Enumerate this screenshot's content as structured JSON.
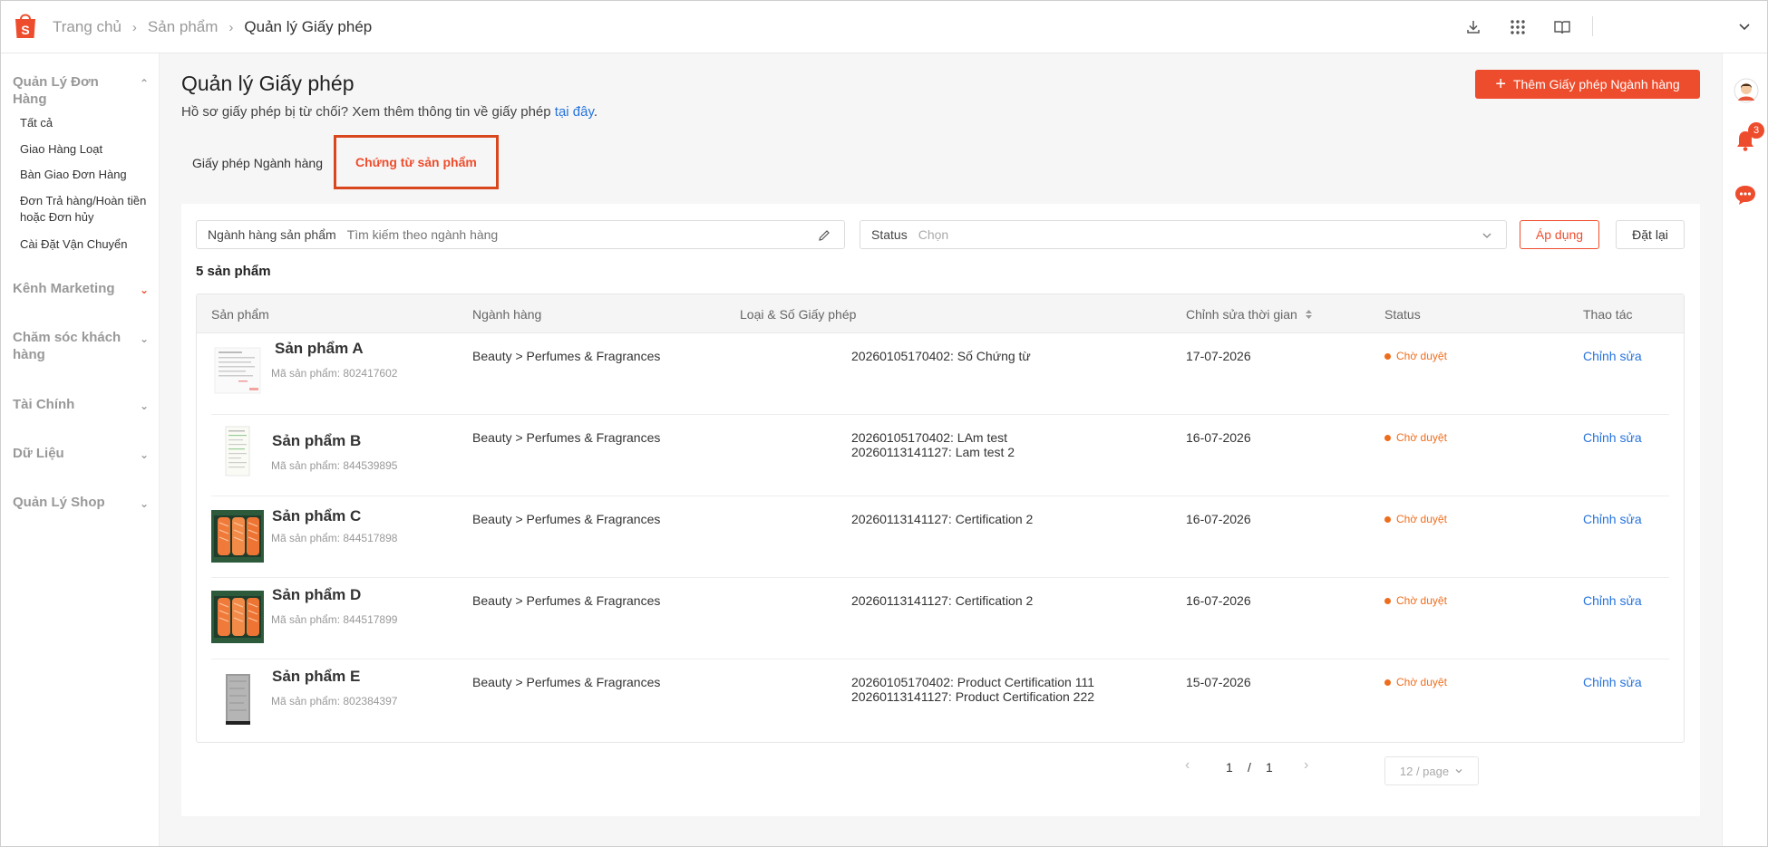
{
  "topbar": {
    "breadcrumbs": [
      "Trang chủ",
      "Sản phẩm",
      "Quản lý Giấy phép"
    ],
    "icons": [
      "download-icon",
      "apps-grid-icon",
      "book-icon",
      "chevron-down-icon"
    ]
  },
  "sidebar": {
    "groups": [
      {
        "label": "Quản Lý Đơn Hàng",
        "expanded": true,
        "items": [
          "Tất cả",
          "Giao Hàng Loạt",
          "Bàn Giao Đơn Hàng",
          "Đơn Trả hàng/Hoàn tiền hoặc Đơn hủy",
          "Cài Đặt Vận Chuyển"
        ]
      },
      {
        "label": "Kênh Marketing"
      },
      {
        "label": "Chăm sóc khách hàng"
      },
      {
        "label": "Tài Chính"
      },
      {
        "label": "Dữ Liệu"
      },
      {
        "label": "Quản Lý Shop"
      }
    ]
  },
  "page": {
    "title": "Quản lý Giấy phép",
    "subtitle_prefix": "Hồ sơ giấy phép bị từ chối? Xem thêm thông tin về giấy phép ",
    "subtitle_link": "tại đây",
    "subtitle_suffix": ".",
    "add_button": "Thêm Giấy phép Ngành hàng"
  },
  "tabs": [
    {
      "label": "Giấy phép Ngành hàng",
      "active": false
    },
    {
      "label": "Chứng từ sản phẩm",
      "active": true
    }
  ],
  "filters": {
    "category_label": "Ngành hàng sản phẩm",
    "category_placeholder": "Tìm kiếm theo ngành hàng",
    "status_label": "Status",
    "status_placeholder": "Chọn",
    "apply": "Áp dụng",
    "reset": "Đặt lại"
  },
  "count_text": "5 sản phẩm",
  "table": {
    "headers": [
      "Sản phẩm",
      "Ngành hàng",
      "Loại & Số Giấy phép",
      "Chỉnh sửa thời gian",
      "Status",
      "Thao tác"
    ],
    "rows": [
      {
        "name": "Sản phẩm A",
        "id": "Mã sản phẩm: 802417602",
        "category": "Beauty > Perfumes & Fragrances",
        "licenses": [
          "20260105170402: Số Chứng từ"
        ],
        "updated": "17-07-2026",
        "status": "Chờ duyệt",
        "action": "Chỉnh sửa",
        "thumb": "document"
      },
      {
        "name": "Sản phẩm B",
        "id": "Mã sản phẩm: 844539895",
        "category": "Beauty > Perfumes & Fragrances",
        "licenses": [
          "20260105170402: LAm test",
          "20260113141127: Lam test 2"
        ],
        "updated": "16-07-2026",
        "status": "Chờ duyệt",
        "action": "Chỉnh sửa",
        "thumb": "receipt"
      },
      {
        "name": "Sản phẩm C",
        "id": "Mã sản phẩm: 844517898",
        "category": "Beauty > Perfumes & Fragrances",
        "licenses": [
          "20260113141127: Certification 2"
        ],
        "updated": "16-07-2026",
        "status": "Chờ duyệt",
        "action": "Chỉnh sửa",
        "thumb": "salmon"
      },
      {
        "name": "Sản phẩm D",
        "id": "Mã sản phẩm: 844517899",
        "category": "Beauty > Perfumes & Fragrances",
        "licenses": [
          "20260113141127: Certification 2"
        ],
        "updated": "16-07-2026",
        "status": "Chờ duyệt",
        "action": "Chỉnh sửa",
        "thumb": "salmon"
      },
      {
        "name": "Sản phẩm E",
        "id": "Mã sản phẩm: 802384397",
        "category": "Beauty > Perfumes & Fragrances",
        "licenses": [
          "20260105170402: Product Certification 111",
          "20260113141127: Product Certification 222"
        ],
        "updated": "15-07-2026",
        "status": "Chờ duyệt",
        "action": "Chỉnh sửa",
        "thumb": "bottle"
      }
    ]
  },
  "pagination": {
    "current": "1",
    "separator": "/",
    "total": "1",
    "page_size": "12 / page"
  },
  "rail": {
    "notification_count": "3"
  },
  "colors": {
    "accent": "#ee4d2d",
    "link": "#2673dd",
    "status_pending": "#ee6d1d"
  }
}
